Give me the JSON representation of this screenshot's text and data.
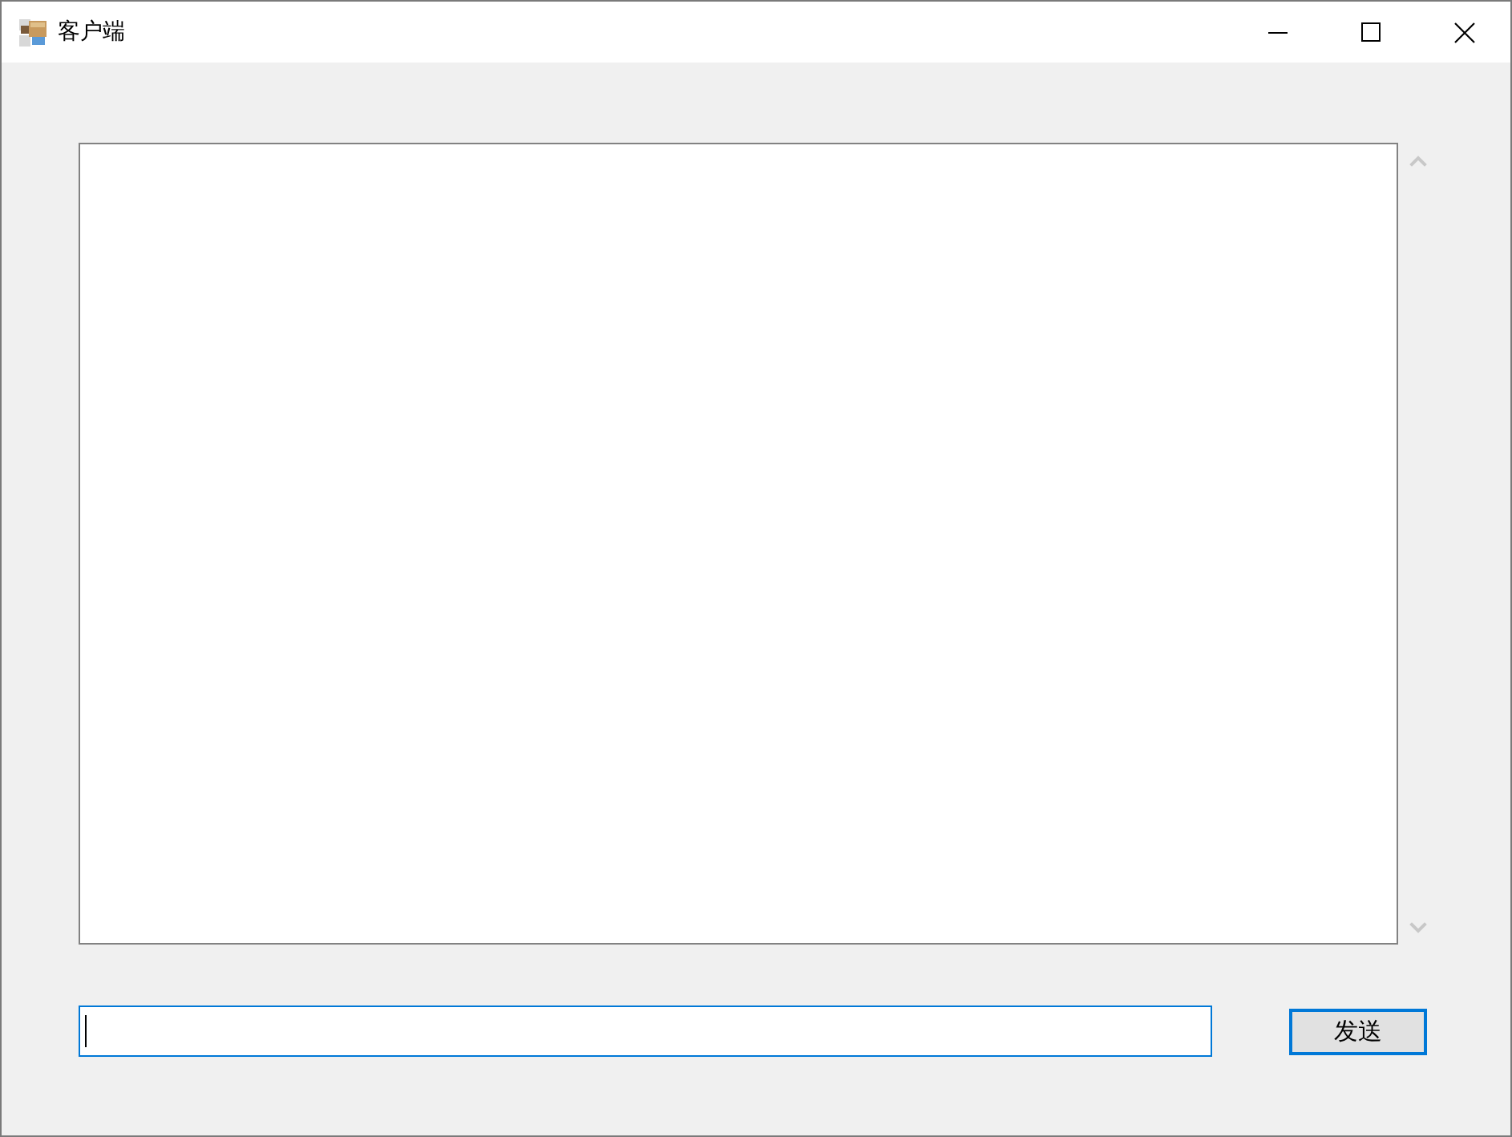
{
  "window": {
    "title": "客户端"
  },
  "message_log": {
    "scroll_disabled": true
  },
  "message_input": {
    "focused": true
  },
  "send_button": {
    "label": "发送",
    "default": true
  }
}
